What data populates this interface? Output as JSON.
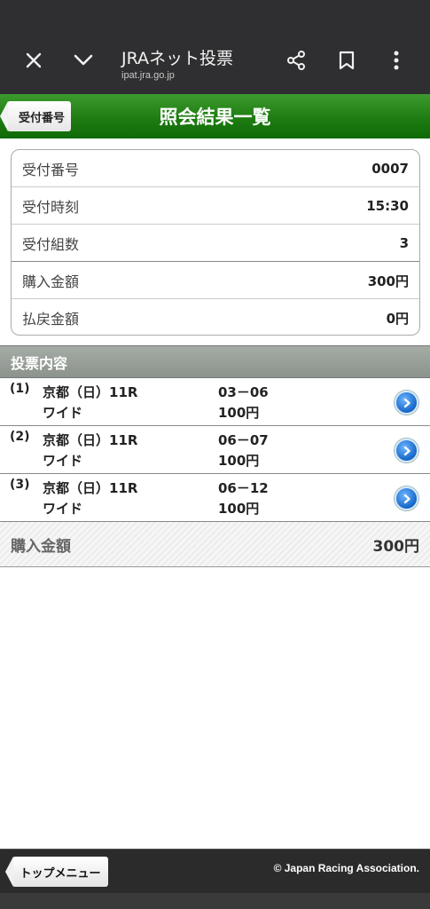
{
  "browser": {
    "title": "JRAネット投票",
    "url": "ipat.jra.go.jp",
    "icons": [
      "close-icon",
      "chevron-down-icon",
      "share-icon",
      "bookmark-icon",
      "more-vert-icon"
    ]
  },
  "header": {
    "back_label": "受付番号",
    "title": "照会結果一覧",
    "color": "#1e7c12"
  },
  "receipt": {
    "rows": [
      {
        "label": "受付番号",
        "value": "0007"
      },
      {
        "label": "受付時刻",
        "value": "15:30"
      },
      {
        "label": "受付組数",
        "value": "3"
      },
      {
        "label": "購入金額",
        "value": "300円"
      },
      {
        "label": "払戻金額",
        "value": "0円"
      }
    ]
  },
  "section": {
    "title": "投票内容"
  },
  "bets": [
    {
      "index": "(1)",
      "race": "京都（日）11R",
      "type": "ワイド",
      "combo": "03－06",
      "amount": "100円"
    },
    {
      "index": "(2)",
      "race": "京都（日）11R",
      "type": "ワイド",
      "combo": "06－07",
      "amount": "100円"
    },
    {
      "index": "(3)",
      "race": "京都（日）11R",
      "type": "ワイド",
      "combo": "06－12",
      "amount": "100円"
    }
  ],
  "total": {
    "label": "購入金額",
    "value": "300円"
  },
  "footer": {
    "top_menu_label": "トップメニュー",
    "copyright": "© Japan Racing Association."
  }
}
